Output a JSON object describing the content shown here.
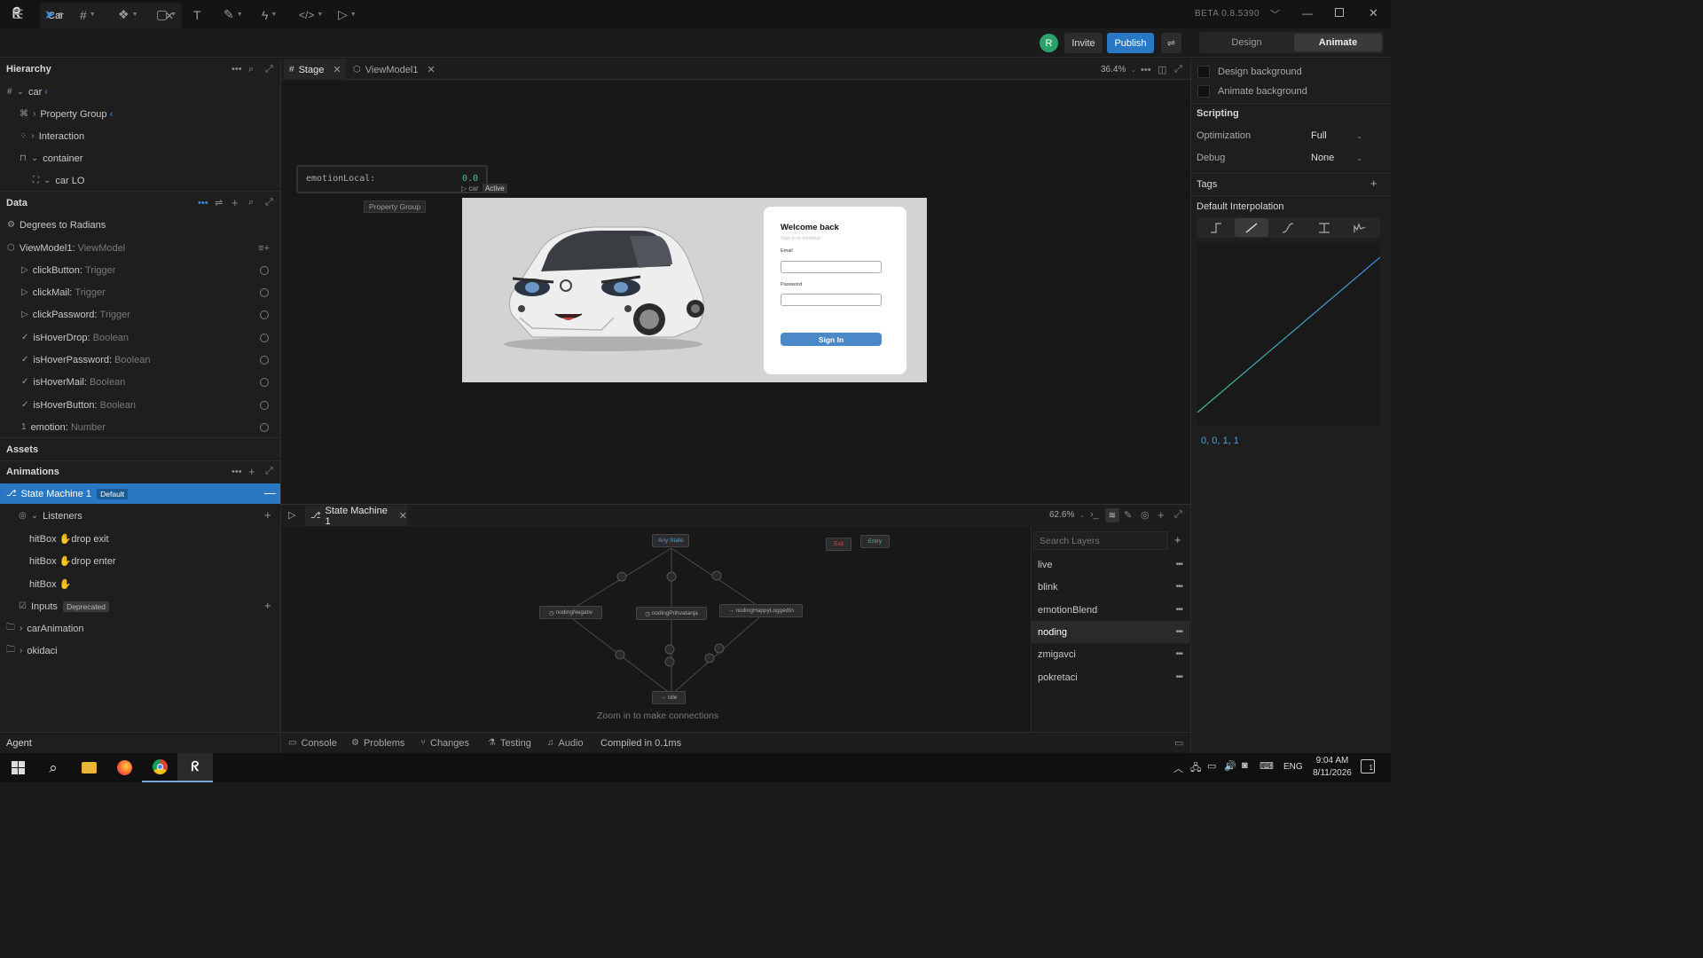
{
  "app": {
    "doc_tab": "Car",
    "version": "BETA 0.8.5390",
    "user_initial": "R",
    "invite": "Invite",
    "publish": "Publish",
    "mode_design": "Design",
    "mode_animate": "Animate",
    "accent": "#2a78c4"
  },
  "hierarchy": {
    "title": "Hierarchy",
    "items": [
      {
        "label": "car",
        "marker": "‹"
      },
      {
        "label": "Property Group",
        "marker": "‹"
      },
      {
        "label": "Interaction"
      },
      {
        "label": "container"
      },
      {
        "label": "car LO"
      }
    ]
  },
  "data_panel": {
    "title": "Data",
    "items": [
      {
        "label": "Degrees to Radians"
      },
      {
        "label": "ViewModel1:",
        "type": "ViewModel"
      },
      {
        "label": "clickButton:",
        "type": "Trigger"
      },
      {
        "label": "clickMail:",
        "type": "Trigger"
      },
      {
        "label": "clickPassword:",
        "type": "Trigger"
      },
      {
        "label": "isHoverDrop:",
        "type": "Boolean"
      },
      {
        "label": "isHoverPassword:",
        "type": "Boolean"
      },
      {
        "label": "isHoverMail:",
        "type": "Boolean"
      },
      {
        "label": "isHoverButton:",
        "type": "Boolean"
      },
      {
        "label": "emotion:",
        "type": "Number"
      }
    ]
  },
  "assets_title": "Assets",
  "animations": {
    "title": "Animations",
    "state_machine": "State Machine 1",
    "default_badge": "Default",
    "listeners": "Listeners",
    "listener_items": [
      "hitBox",
      "hitBox",
      "hitBox"
    ],
    "listener_actions": [
      "drop exit",
      "drop enter",
      ""
    ],
    "inputs": "Inputs",
    "deprecated": "Deprecated",
    "folders": [
      "carAnimation",
      "okidaci"
    ]
  },
  "agent_title": "Agent",
  "stage": {
    "tab_stage": "Stage",
    "tab_viewmodel": "ViewModel1",
    "zoom": "36.4%",
    "emotion_label": "emotionLocal:",
    "emotion_value": "0.0",
    "car_tag": "car",
    "active_tag": "Active",
    "property_group": "Property Group",
    "login": {
      "title": "Welcome back",
      "subtitle": "Sign in to continue",
      "email": "Email",
      "password": "Password",
      "button": "Sign In"
    }
  },
  "state_machine": {
    "tab": "State Machine 1",
    "zoom": "62.6%",
    "nodes": {
      "any": "Any State",
      "exit": "Exit",
      "entry": "Entry",
      "neg": "nodingNegativ",
      "pri": "nodingPrihvatanja",
      "happy": "nodingHappyLoggedIn",
      "idle": "Idle"
    },
    "hint": "Zoom in to make connections",
    "search_placeholder": "Search Layers",
    "layers": [
      "live",
      "blink",
      "emotionBlend",
      "noding",
      "zmigavci",
      "pokretaci"
    ]
  },
  "bottom_bar": {
    "console": "Console",
    "problems": "Problems",
    "changes": "Changes",
    "testing": "Testing",
    "audio": "Audio",
    "compiled": "Compiled in 0.1ms"
  },
  "inspector": {
    "design_bg": "Design background",
    "animate_bg": "Animate background",
    "scripting": "Scripting",
    "optimization_label": "Optimization",
    "optimization_value": "Full",
    "debug_label": "Debug",
    "debug_value": "None",
    "tags": "Tags",
    "default_interp": "Default Interpolation",
    "curve_values": "0, 0, 1, 1"
  },
  "taskbar": {
    "lang": "ENG",
    "time": "9:04 AM",
    "date": "8/11/2026",
    "notif": "1"
  }
}
